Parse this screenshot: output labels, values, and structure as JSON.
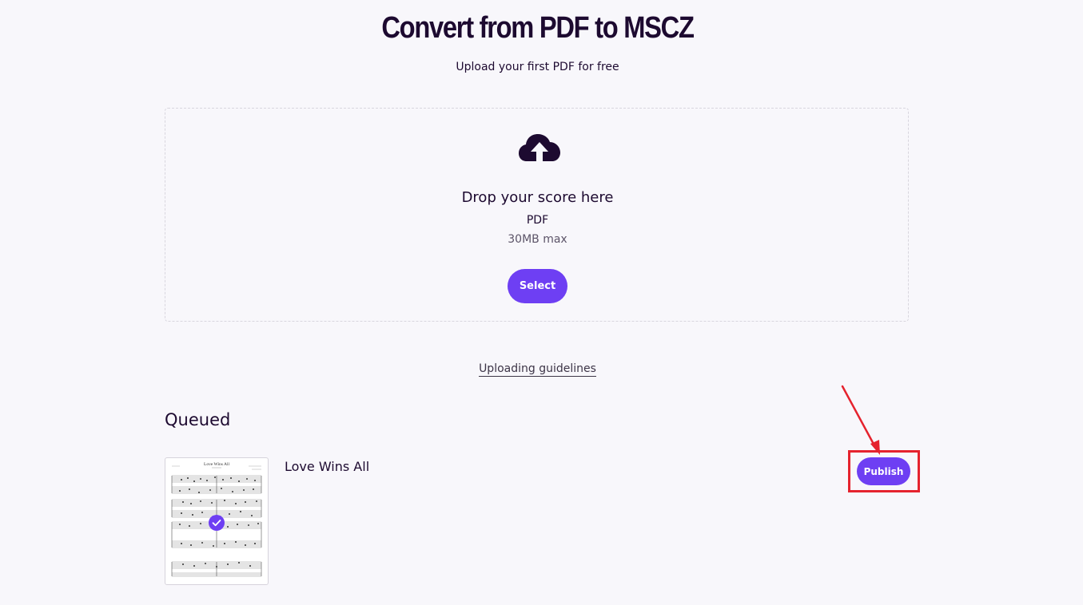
{
  "header": {
    "title": "Convert from PDF to MSCZ",
    "subtitle": "Upload your first PDF for free"
  },
  "dropzone": {
    "icon": "cloud-upload-icon",
    "heading": "Drop your score here",
    "format": "PDF",
    "max_size": "30MB max",
    "select_label": "Select"
  },
  "guidelines": {
    "label": "Uploading guidelines"
  },
  "queue": {
    "heading": "Queued",
    "items": [
      {
        "title": "Love Wins All",
        "thumbnail_title": "Love Wins All",
        "status_icon": "check-icon",
        "publish_label": "Publish"
      }
    ]
  },
  "colors": {
    "accent": "#6e3ff3",
    "text": "#1d0a30",
    "background": "#f8f7fb",
    "annotation_red": "#e5232e"
  }
}
